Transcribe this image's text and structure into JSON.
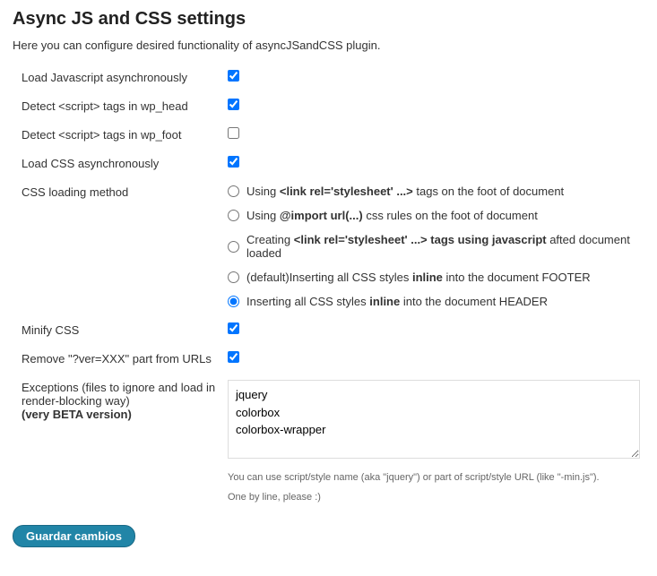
{
  "title": "Async JS and CSS settings",
  "description": "Here you can configure desired functionality of asyncJSandCSS plugin.",
  "fields": {
    "load_js_async": {
      "label": "Load Javascript asynchronously",
      "checked": true
    },
    "detect_head": {
      "label": "Detect <script> tags in wp_head",
      "checked": true
    },
    "detect_foot": {
      "label": "Detect <script> tags in wp_foot",
      "checked": false
    },
    "load_css_async": {
      "label": "Load CSS asynchronously",
      "checked": true
    },
    "css_method": {
      "label": "CSS loading method",
      "selected": 4,
      "options": [
        "Using <b>&lt;link rel='stylesheet' ...&gt;</b> tags on the foot of document",
        "Using <b>@import url(...)</b> css rules on the foot of document",
        "Creating <b>&lt;link rel='stylesheet' ...&gt; tags using javascript</b> afted document loaded",
        "(default)Inserting all CSS styles <b>inline</b> into the document FOOTER",
        "Inserting all CSS styles <b>inline</b> into the document HEADER"
      ]
    },
    "minify_css": {
      "label": "Minify CSS",
      "checked": true
    },
    "remove_ver": {
      "label": "Remove \"?ver=XXX\" part from URLs",
      "checked": true
    },
    "exceptions": {
      "label": "Exceptions (files to ignore and load in render-blocking way)",
      "label_strong": "(very BETA version)",
      "value": "jquery\ncolorbox\ncolorbox-wrapper",
      "help1": "You can use script/style name (aka \"jquery\") or part of script/style URL (like \"-min.js\").",
      "help2": "One by line, please :)"
    }
  },
  "submit_label": "Guardar cambios"
}
